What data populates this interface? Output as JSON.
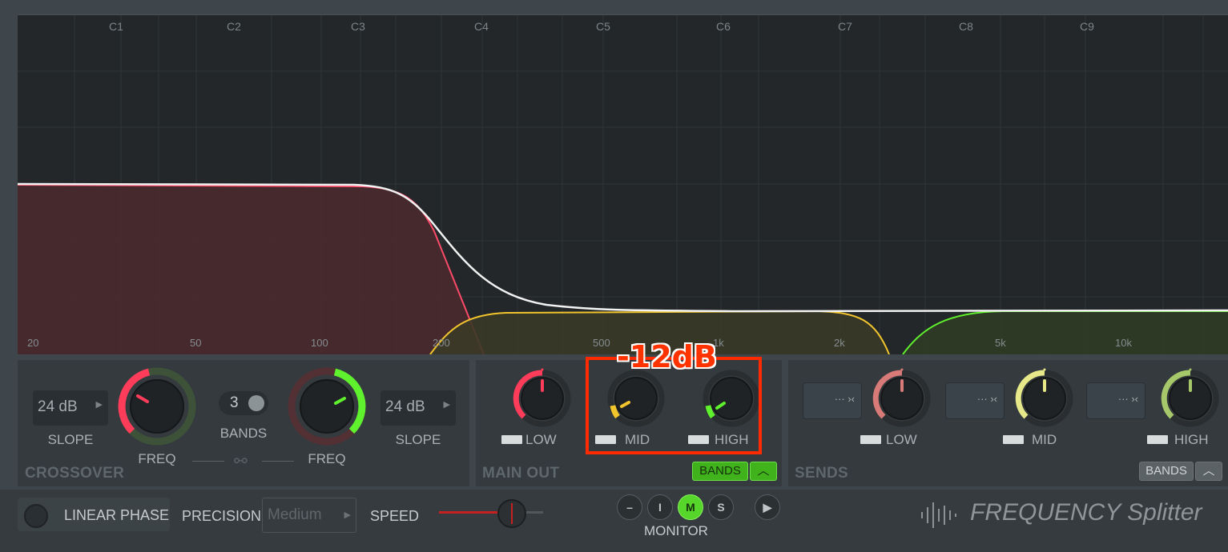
{
  "graph": {
    "notes": [
      "C1",
      "C2",
      "C3",
      "C4",
      "C5",
      "C6",
      "C7",
      "C8",
      "C9"
    ],
    "freq_labels": [
      "20",
      "50",
      "100",
      "200",
      "500",
      "1k",
      "2k",
      "5k",
      "10k"
    ]
  },
  "crossover": {
    "section_label": "CROSSOVER",
    "slope_left": {
      "value": "24 dB",
      "label": "SLOPE"
    },
    "freq_left_label": "FREQ",
    "bands": {
      "value": "3",
      "label": "BANDS"
    },
    "freq_right_label": "FREQ",
    "slope_right": {
      "value": "24 dB",
      "label": "SLOPE"
    }
  },
  "main_out": {
    "section_label": "MAIN OUT",
    "channels": [
      {
        "label": "LOW",
        "color": "#ff3c5a"
      },
      {
        "label": "MID",
        "color": "#f2c52c"
      },
      {
        "label": "HIGH",
        "color": "#5ff02e"
      }
    ],
    "bands_button": "BANDS"
  },
  "sends": {
    "section_label": "SENDS",
    "channels": [
      {
        "label": "LOW",
        "color": "#d77a78"
      },
      {
        "label": "MID",
        "color": "#e6e88a"
      },
      {
        "label": "HIGH",
        "color": "#a6c86a"
      }
    ],
    "bands_button": "BANDS"
  },
  "bottom_bar": {
    "linear_phase": "LINEAR PHASE",
    "precision_label": "PRECISION",
    "precision_value": "Medium",
    "speed_label": "SPEED",
    "monitor_label": "MONITOR",
    "monitor_buttons": [
      "–",
      "I",
      "M",
      "S"
    ],
    "monitor_active": "M",
    "title": "FREQUENCY Splitter"
  },
  "annotation": {
    "text": "-12dB",
    "color": "#ff3300"
  }
}
